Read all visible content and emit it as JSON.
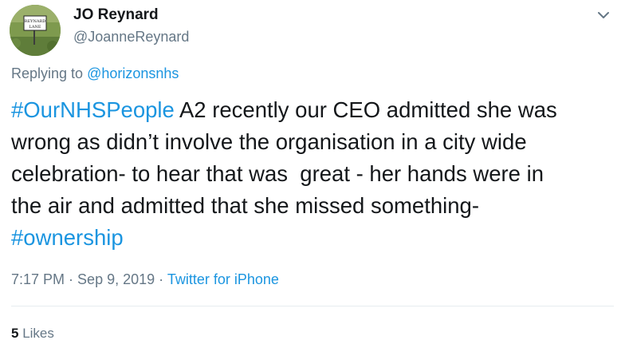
{
  "author": {
    "display_name": "JO Reynard",
    "handle": "@JoanneReynard",
    "avatar_sign_lines": [
      "REYNARD",
      "LANE"
    ]
  },
  "reply": {
    "prefix": "Replying to ",
    "target": "@horizonsnhs"
  },
  "body": {
    "line1_hashtag": "#OurNHSPeople",
    "line1_text": " A2 recently our CEO admitted she was",
    "line2": "wrong as didn’t involve the organisation in a city wide",
    "line3": "celebration- to hear that was  great - her hands were in",
    "line4": "the air and admitted that she missed something-",
    "line5_hashtag": "#ownership"
  },
  "meta": {
    "time": "7:17 PM",
    "separator1": " · ",
    "date": "Sep 9, 2019",
    "separator2": " · ",
    "source": "Twitter for iPhone"
  },
  "stats": {
    "likes_count": "5",
    "likes_label": " Likes"
  },
  "icons": {
    "menu": "chevron-down-icon"
  },
  "colors": {
    "link": "#1b95e0",
    "secondary_text": "#657786",
    "primary_text": "#14171a",
    "divider": "#e6ecf0"
  }
}
